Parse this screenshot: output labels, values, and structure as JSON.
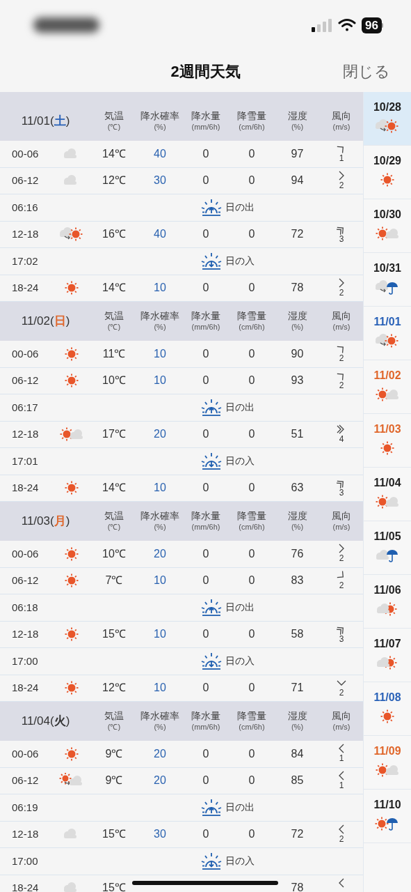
{
  "status_bar": {
    "battery": "96"
  },
  "nav": {
    "title": "2週間天気",
    "close": "閉じる"
  },
  "days": [
    {
      "date": "11/01",
      "open": "(",
      "weekday": "土",
      "close": ")",
      "color": "#2a62b8",
      "columns": [
        {
          "label": "気温",
          "unit": "(℃)"
        },
        {
          "label": "降水確率",
          "unit": "(%)"
        },
        {
          "label": "降水量",
          "unit": "(mm/6h)"
        },
        {
          "label": "降雪量",
          "unit": "(cm/6h)"
        },
        {
          "label": "湿度",
          "unit": "(%)"
        },
        {
          "label": "風向",
          "unit": "(m/s)"
        }
      ],
      "rows": [
        {
          "kind": "forecast",
          "time": "00-06",
          "weather": {
            "kind": "cloud"
          },
          "temp": "14℃",
          "pop": "40",
          "rain": "0",
          "snow": "0",
          "humidity": "97",
          "wind": {
            "kind": "ne",
            "strong": false
          },
          "speed": "1"
        },
        {
          "kind": "forecast",
          "time": "06-12",
          "weather": {
            "kind": "cloud"
          },
          "temp": "12℃",
          "pop": "30",
          "rain": "0",
          "snow": "0",
          "humidity": "94",
          "wind": {
            "kind": "e",
            "strong": false
          },
          "speed": "2"
        },
        {
          "kind": "sunrise",
          "time": "06:16",
          "label": "日の出"
        },
        {
          "kind": "forecast",
          "time": "12-18",
          "weather": {
            "kind": "cloud-to-sun"
          },
          "temp": "16℃",
          "pop": "40",
          "rain": "0",
          "snow": "0",
          "humidity": "72",
          "wind": {
            "kind": "ne",
            "strong": true
          },
          "speed": "3"
        },
        {
          "kind": "sunset",
          "time": "17:02",
          "label": "日の入"
        },
        {
          "kind": "forecast",
          "time": "18-24",
          "weather": {
            "kind": "sun"
          },
          "temp": "14℃",
          "pop": "10",
          "rain": "0",
          "snow": "0",
          "humidity": "78",
          "wind": {
            "kind": "e",
            "strong": false
          },
          "speed": "2"
        }
      ]
    },
    {
      "date": "11/02",
      "open": "(",
      "weekday": "日",
      "close": ")",
      "color": "#e0662a",
      "columns": [
        {
          "label": "気温",
          "unit": "(℃)"
        },
        {
          "label": "降水確率",
          "unit": "(%)"
        },
        {
          "label": "降水量",
          "unit": "(mm/6h)"
        },
        {
          "label": "降雪量",
          "unit": "(cm/6h)"
        },
        {
          "label": "湿度",
          "unit": "(%)"
        },
        {
          "label": "風向",
          "unit": "(m/s)"
        }
      ],
      "rows": [
        {
          "kind": "forecast",
          "time": "00-06",
          "weather": {
            "kind": "sun"
          },
          "temp": "11℃",
          "pop": "10",
          "rain": "0",
          "snow": "0",
          "humidity": "90",
          "wind": {
            "kind": "ne",
            "strong": false
          },
          "speed": "2"
        },
        {
          "kind": "forecast",
          "time": "06-12",
          "weather": {
            "kind": "sun"
          },
          "temp": "10℃",
          "pop": "10",
          "rain": "0",
          "snow": "0",
          "humidity": "93",
          "wind": {
            "kind": "ne",
            "strong": false
          },
          "speed": "2"
        },
        {
          "kind": "sunrise",
          "time": "06:17",
          "label": "日の出"
        },
        {
          "kind": "forecast",
          "time": "12-18",
          "weather": {
            "kind": "sun-cloud"
          },
          "temp": "17℃",
          "pop": "20",
          "rain": "0",
          "snow": "0",
          "humidity": "51",
          "wind": {
            "kind": "e",
            "strong": true
          },
          "speed": "4"
        },
        {
          "kind": "sunset",
          "time": "17:01",
          "label": "日の入"
        },
        {
          "kind": "forecast",
          "time": "18-24",
          "weather": {
            "kind": "sun"
          },
          "temp": "14℃",
          "pop": "10",
          "rain": "0",
          "snow": "0",
          "humidity": "63",
          "wind": {
            "kind": "ne",
            "strong": true
          },
          "speed": "3"
        }
      ]
    },
    {
      "date": "11/03",
      "open": "(",
      "weekday": "月",
      "close": ")",
      "color": "#e0662a",
      "columns": [
        {
          "label": "気温",
          "unit": "(℃)"
        },
        {
          "label": "降水確率",
          "unit": "(%)"
        },
        {
          "label": "降水量",
          "unit": "(mm/6h)"
        },
        {
          "label": "降雪量",
          "unit": "(cm/6h)"
        },
        {
          "label": "湿度",
          "unit": "(%)"
        },
        {
          "label": "風向",
          "unit": "(m/s)"
        }
      ],
      "rows": [
        {
          "kind": "forecast",
          "time": "00-06",
          "weather": {
            "kind": "sun"
          },
          "temp": "10℃",
          "pop": "20",
          "rain": "0",
          "snow": "0",
          "humidity": "76",
          "wind": {
            "kind": "e",
            "strong": false
          },
          "speed": "2"
        },
        {
          "kind": "forecast",
          "time": "06-12",
          "weather": {
            "kind": "sun"
          },
          "temp": "7℃",
          "pop": "10",
          "rain": "0",
          "snow": "0",
          "humidity": "83",
          "wind": {
            "kind": "se",
            "strong": false
          },
          "speed": "2"
        },
        {
          "kind": "sunrise",
          "time": "06:18",
          "label": "日の出"
        },
        {
          "kind": "forecast",
          "time": "12-18",
          "weather": {
            "kind": "sun"
          },
          "temp": "15℃",
          "pop": "10",
          "rain": "0",
          "snow": "0",
          "humidity": "58",
          "wind": {
            "kind": "ne",
            "strong": true
          },
          "speed": "3"
        },
        {
          "kind": "sunset",
          "time": "17:00",
          "label": "日の入"
        },
        {
          "kind": "forecast",
          "time": "18-24",
          "weather": {
            "kind": "sun"
          },
          "temp": "12℃",
          "pop": "10",
          "rain": "0",
          "snow": "0",
          "humidity": "71",
          "wind": {
            "kind": "s",
            "strong": false
          },
          "speed": "2"
        }
      ]
    },
    {
      "date": "11/04",
      "open": "(",
      "weekday": "火",
      "close": ")",
      "color": "#333333",
      "columns": [
        {
          "label": "気温",
          "unit": "(℃)"
        },
        {
          "label": "降水確率",
          "unit": "(%)"
        },
        {
          "label": "降水量",
          "unit": "(mm/6h)"
        },
        {
          "label": "降雪量",
          "unit": "(cm/6h)"
        },
        {
          "label": "湿度",
          "unit": "(%)"
        },
        {
          "label": "風向",
          "unit": "(m/s)"
        }
      ],
      "rows": [
        {
          "kind": "forecast",
          "time": "00-06",
          "weather": {
            "kind": "sun"
          },
          "temp": "9℃",
          "pop": "20",
          "rain": "0",
          "snow": "0",
          "humidity": "84",
          "wind": {
            "kind": "w",
            "strong": false
          },
          "speed": "1"
        },
        {
          "kind": "forecast",
          "time": "06-12",
          "weather": {
            "kind": "sun-to-cloud"
          },
          "temp": "9℃",
          "pop": "20",
          "rain": "0",
          "snow": "0",
          "humidity": "85",
          "wind": {
            "kind": "w",
            "strong": false
          },
          "speed": "1"
        },
        {
          "kind": "sunrise",
          "time": "06:19",
          "label": "日の出"
        },
        {
          "kind": "forecast",
          "time": "12-18",
          "weather": {
            "kind": "cloud"
          },
          "temp": "15℃",
          "pop": "30",
          "rain": "0",
          "snow": "0",
          "humidity": "72",
          "wind": {
            "kind": "w",
            "strong": false
          },
          "speed": "2"
        },
        {
          "kind": "sunset",
          "time": "17:00",
          "label": "日の入"
        },
        {
          "kind": "forecast",
          "time": "18-24",
          "weather": {
            "kind": "cloud"
          },
          "temp": "15℃",
          "humidity": "78",
          "wind": {
            "kind": "w",
            "strong": false
          }
        }
      ]
    }
  ],
  "sidebar": [
    {
      "date": "10/28",
      "weather": {
        "kind": "cloud-to-sun"
      },
      "color": "#222222",
      "selected": true
    },
    {
      "date": "10/29",
      "weather": {
        "kind": "sun"
      },
      "color": "#222222",
      "selected": false
    },
    {
      "date": "10/30",
      "weather": {
        "kind": "sun-cloud"
      },
      "color": "#222222",
      "selected": false
    },
    {
      "date": "10/31",
      "weather": {
        "kind": "cloud-to-rain"
      },
      "color": "#222222",
      "selected": false
    },
    {
      "date": "11/01",
      "weather": {
        "kind": "cloud-to-sun"
      },
      "color": "#2a62b8",
      "selected": false
    },
    {
      "date": "11/02",
      "weather": {
        "kind": "sun-cloud"
      },
      "color": "#e0662a",
      "selected": false
    },
    {
      "date": "11/03",
      "weather": {
        "kind": "sun"
      },
      "color": "#e0662a",
      "selected": false
    },
    {
      "date": "11/04",
      "weather": {
        "kind": "sun-cloud"
      },
      "color": "#222222",
      "selected": false
    },
    {
      "date": "11/05",
      "weather": {
        "kind": "cloud-rain"
      },
      "color": "#222222",
      "selected": false
    },
    {
      "date": "11/06",
      "weather": {
        "kind": "cloud-sun"
      },
      "color": "#222222",
      "selected": false
    },
    {
      "date": "11/07",
      "weather": {
        "kind": "cloud-sun"
      },
      "color": "#222222",
      "selected": false
    },
    {
      "date": "11/08",
      "weather": {
        "kind": "sun"
      },
      "color": "#2a62b8",
      "selected": false
    },
    {
      "date": "11/09",
      "weather": {
        "kind": "sun-cloud"
      },
      "color": "#e0662a",
      "selected": false
    },
    {
      "date": "11/10",
      "weather": {
        "kind": "sun-rain"
      },
      "color": "#222222",
      "selected": false
    }
  ]
}
